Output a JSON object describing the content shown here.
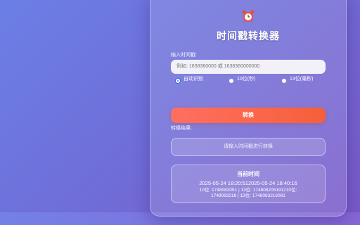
{
  "app": {
    "title": "时间戳转换器",
    "icon": "alarm-clock-icon"
  },
  "input": {
    "label": "输入时间戳:",
    "placeholder": "例如: 1638360000 或 1638360000000",
    "value": ""
  },
  "format_options": [
    {
      "label": "自动识别",
      "checked": true
    },
    {
      "label": "10位(秒)",
      "checked": false
    },
    {
      "label": "13位(毫秒)",
      "checked": false
    }
  ],
  "convert_button": {
    "label": "转换"
  },
  "result": {
    "label": "转换结果:",
    "text": "请输入时间戳进行转换"
  },
  "current": {
    "title": "当前时间",
    "time": "2025-05-24 18:20:512025-05-24 18:40:16",
    "timestamps_line1": "10位: 1748082051 | 13位: 174808205191210位:",
    "timestamps_line2": "1748083216 | 13位: 1748083216081"
  },
  "colors": {
    "accent_button": "#f5603a",
    "radio_checked": "#2a6af0"
  }
}
